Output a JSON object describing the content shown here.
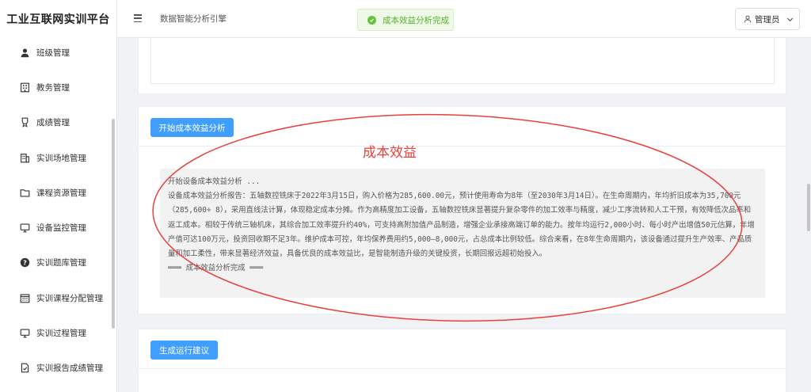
{
  "brand": "工业互联网实训平台",
  "sidebar": {
    "items": [
      {
        "label": "班级管理",
        "icon": "user-icon"
      },
      {
        "label": "教务管理",
        "icon": "building-icon"
      },
      {
        "label": "成绩管理",
        "icon": "medal-icon"
      },
      {
        "label": "实训场地管理",
        "icon": "office-icon"
      },
      {
        "label": "课程资源管理",
        "icon": "folder-icon"
      },
      {
        "label": "设备监控管理",
        "icon": "monitor-icon"
      },
      {
        "label": "实训题库管理",
        "icon": "question-icon"
      },
      {
        "label": "实训课程分配管理",
        "icon": "calendar-icon"
      },
      {
        "label": "实训过程管理",
        "icon": "monitor-icon"
      },
      {
        "label": "实训报告成绩管理",
        "icon": "document-icon"
      }
    ]
  },
  "header": {
    "breadcrumb": "数据智能分析引擎",
    "toast": "成本效益分析完成",
    "user": "管理员"
  },
  "analysis": {
    "button": "开始成本效益分析",
    "lines": [
      "开始设备成本效益分析 ...",
      "设备成本效益分析报告：五轴数控铣床于2022年3月15日，购入价格为285,600.00元，预计使用寿命为8年（至2030年3月14日）。在生命周期内，年均折旧成本为35,700元（285,600÷ 8），采用直线法计算，体现稳定成本分摊。作为高精度加工设备，五轴数控铣床显著提升复杂零件的加工效率与精度，减少工序流转和人工干预，有效降低次品率和返工成本。相较于传统三轴机床，其综合加工效率提升约40%，可支持高附加值产品制造，增强企业承接高端订单的能力。按年均运行2,000小时、每小时产出增值50元估算，年增产值可达100万元，投资回收期不足3年。维护成本可控，年均保养费用约5,000–8,000元，占总成本比例较低。综合来看，在8年生命周期内，该设备通过提升生产效率、产品质量和加工柔性，带来显著经济效益，具备优良的成本效益比，是智能制造升级的关键投资，长期回报远超初始投入。",
      "═══  成本效益分析完成  ═══"
    ]
  },
  "annotation": {
    "label": "成本效益",
    "color": "#e8403a"
  },
  "suggestion": {
    "button": "生成运行建议"
  },
  "colors": {
    "primary": "#409eff",
    "success": "#67c23a"
  }
}
